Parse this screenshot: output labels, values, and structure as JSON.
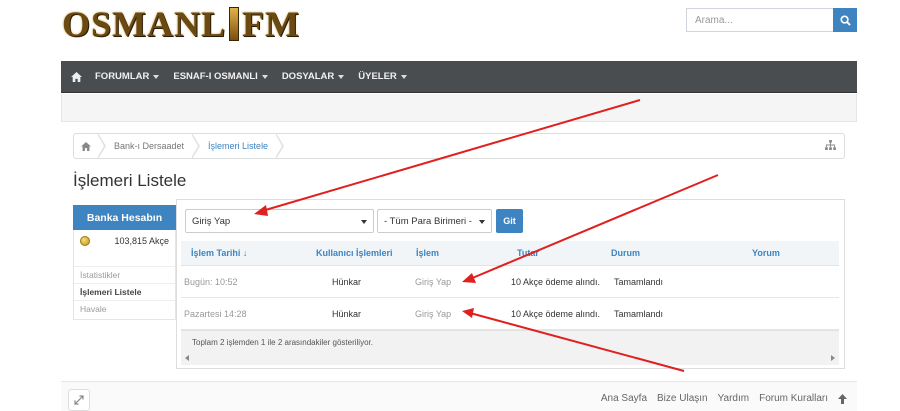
{
  "brand": {
    "logo_left": "OSMANL",
    "logo_right": "FM"
  },
  "search": {
    "placeholder": "Arama..."
  },
  "navbar": {
    "items": [
      {
        "label": "FORUMLAR"
      },
      {
        "label": "ESNAF-I OSMANLI"
      },
      {
        "label": "DOSYALAR"
      },
      {
        "label": "ÜYELER"
      }
    ]
  },
  "breadcrumb": {
    "items": [
      {
        "label": "Bank-ı Dersaadet"
      },
      {
        "label": "İşlemeri Listele"
      }
    ]
  },
  "page": {
    "title": "İşlemeri Listele"
  },
  "sidebar": {
    "header": "Banka Hesabın",
    "balance": "103,815 Akçe",
    "links": [
      {
        "label": "İstatistikler"
      },
      {
        "label": "İşlemeri Listele"
      },
      {
        "label": "Havale"
      }
    ]
  },
  "filters": {
    "type_value": "Giriş Yap",
    "currency_value": "- Tüm Para Birimeri -",
    "go_label": "Git"
  },
  "table": {
    "headers": [
      "İşlem Tarihi ↓",
      "Kullanıcı İşlemleri",
      "İşlem",
      "Tutar",
      "Durum",
      "Yorum"
    ],
    "rows": [
      [
        "Bugün: 10:52",
        "Hünkar",
        "Giriş Yap",
        "10 Akçe ödeme alındı.",
        "Tamamlandı",
        ""
      ],
      [
        "Pazartesi 14:28",
        "Hünkar",
        "Giriş Yap",
        "10 Akçe ödeme alındı.",
        "Tamamlandı",
        ""
      ]
    ],
    "summary": "Toplam 2 işlemden 1 ile 2 arasındakiler gösteriliyor."
  },
  "footer": {
    "links": [
      {
        "label": "Ana Sayfa"
      },
      {
        "label": "Bize Ulaşın"
      },
      {
        "label": "Yardım"
      },
      {
        "label": "Forum Kuralları"
      }
    ]
  },
  "colors": {
    "accent": "#3d84c0",
    "navbar": "#4a4d50",
    "annotation": "#e02020"
  }
}
